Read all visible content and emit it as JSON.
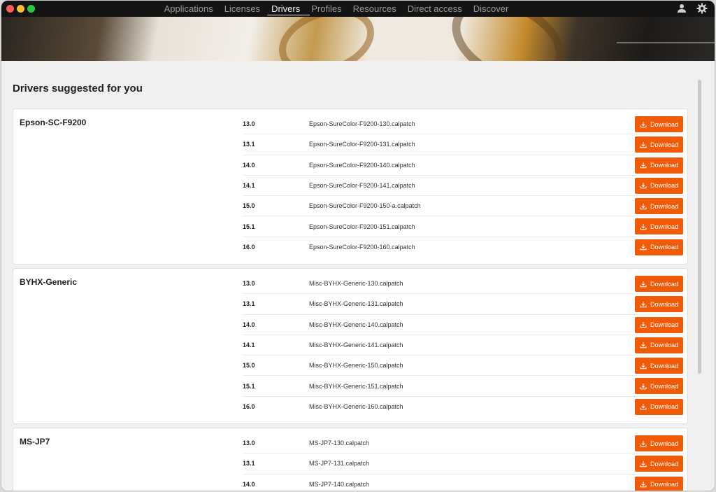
{
  "nav": {
    "items": [
      "Applications",
      "Licenses",
      "Drivers",
      "Profiles",
      "Resources",
      "Direct access",
      "Discover"
    ],
    "active": "Drivers"
  },
  "icons": {
    "user": "user-icon",
    "settings": "gear-icon",
    "download": "download-icon"
  },
  "colors": {
    "accent": "#f15a06",
    "topbar": "#141414"
  },
  "page": {
    "title": "Drivers suggested for you"
  },
  "groups": [
    {
      "name": "Epson-SC-F9200",
      "rows": [
        {
          "version": "13.0",
          "file": "Epson-SureColor-F9200-130.calpatch",
          "action": "Download"
        },
        {
          "version": "13.1",
          "file": "Epson-SureColor-F9200-131.calpatch",
          "action": "Download"
        },
        {
          "version": "14.0",
          "file": "Epson-SureColor-F9200-140.calpatch",
          "action": "Download"
        },
        {
          "version": "14.1",
          "file": "Epson-SureColor-F9200-141.calpatch",
          "action": "Download"
        },
        {
          "version": "15.0",
          "file": "Epson-SureColor-F9200-150-a.calpatch",
          "action": "Download"
        },
        {
          "version": "15.1",
          "file": "Epson-SureColor-F9200-151.calpatch",
          "action": "Download"
        },
        {
          "version": "16.0",
          "file": "Epson-SureColor-F9200-160.calpatch",
          "action": "Download"
        }
      ]
    },
    {
      "name": "BYHX-Generic",
      "rows": [
        {
          "version": "13.0",
          "file": "Misc-BYHX-Generic-130.calpatch",
          "action": "Download"
        },
        {
          "version": "13.1",
          "file": "Misc-BYHX-Generic-131.calpatch",
          "action": "Download"
        },
        {
          "version": "14.0",
          "file": "Misc-BYHX-Generic-140.calpatch",
          "action": "Download"
        },
        {
          "version": "14.1",
          "file": "Misc-BYHX-Generic-141.calpatch",
          "action": "Download"
        },
        {
          "version": "15.0",
          "file": "Misc-BYHX-Generic-150.calpatch",
          "action": "Download"
        },
        {
          "version": "15.1",
          "file": "Misc-BYHX-Generic-151.calpatch",
          "action": "Download"
        },
        {
          "version": "16.0",
          "file": "Misc-BYHX-Generic-160.calpatch",
          "action": "Download"
        }
      ]
    },
    {
      "name": "MS-JP7",
      "rows": [
        {
          "version": "13.0",
          "file": "MS-JP7-130.calpatch",
          "action": "Download"
        },
        {
          "version": "13.1",
          "file": "MS-JP7-131.calpatch",
          "action": "Download"
        },
        {
          "version": "14.0",
          "file": "MS-JP7-140.calpatch",
          "action": "Download"
        }
      ]
    }
  ]
}
